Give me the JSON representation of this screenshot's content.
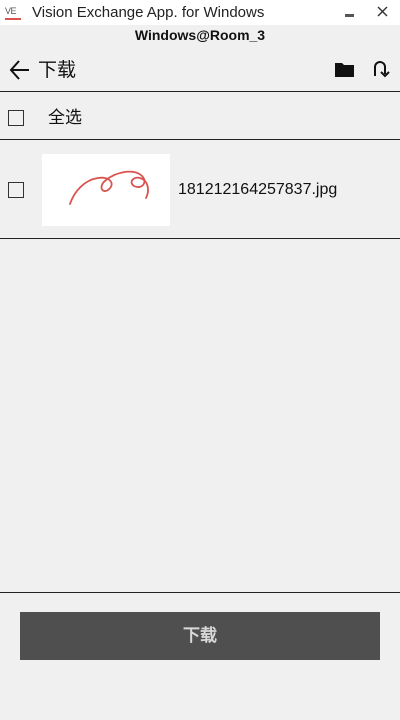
{
  "window": {
    "logo_text": "VE",
    "title": "Vision Exchange App. for Windows",
    "subtitle": "Windows@Room_3",
    "accent_color": "#d9534f"
  },
  "header": {
    "back_icon": "arrow-left-icon",
    "title": "下载",
    "folder_icon": "folder-icon",
    "refresh_icon": "refresh-icon"
  },
  "select_all": {
    "label": "全选",
    "checked": false
  },
  "files": [
    {
      "name": "181212164257837.jpg",
      "checked": false,
      "thumbnail": "handwritten-scribble-thumbnail"
    }
  ],
  "footer": {
    "download_label": "下载",
    "button_color": "#4f4f4f"
  }
}
